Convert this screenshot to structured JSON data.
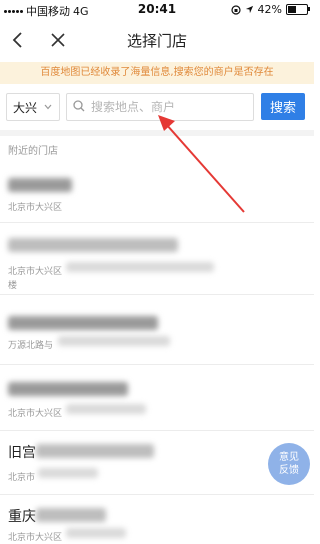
{
  "status_bar": {
    "carrier": "中国移动",
    "network": "4G",
    "time": "20:41",
    "battery": "42%",
    "battery_level": 0.42
  },
  "nav": {
    "back_icon": "chevron-left-icon",
    "close_icon": "close-icon",
    "title": "选择门店"
  },
  "notice": {
    "text": "百度地图已经收录了海量信息,搜索您的商户是否存在",
    "color": "#e0893a",
    "background": "#fcf2dc"
  },
  "search": {
    "city": "大兴",
    "placeholder": "搜索地点、商户",
    "button_label": "搜索",
    "button_color": "#2f7fe6"
  },
  "section_label": "附近的门店",
  "stores": [
    {
      "name": "",
      "address": "北京市大兴区",
      "address_line2": ""
    },
    {
      "name": "",
      "address": "北京市大兴区",
      "address_line2": "楼"
    },
    {
      "name": "",
      "address": "万源北路与",
      "address_line2": ""
    },
    {
      "name": "",
      "address": "北京市大兴区",
      "address_line2": ""
    },
    {
      "name": "旧宫",
      "address": "北京市",
      "address_line2": ""
    },
    {
      "name": "重庆",
      "address": "北京市大兴区",
      "address_line2": ""
    }
  ],
  "feedback": {
    "line1": "意见",
    "line2": "反馈"
  }
}
